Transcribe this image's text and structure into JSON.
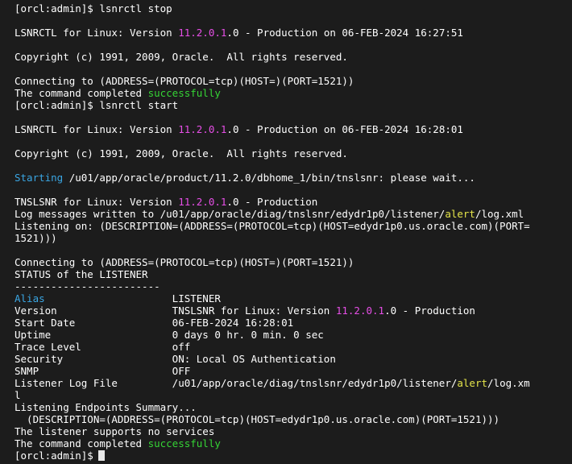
{
  "colors": {
    "background": "#1c1c1c",
    "text": "#ffffff",
    "version": "#e64ee6",
    "success": "#35d435",
    "keyword": "#3aa6e3",
    "highlight": "#e5e54a",
    "cursor": "#e8e8e8"
  },
  "terminal": {
    "lines": [
      [
        {
          "t": "[orcl:admin]$ lsnrctl stop"
        }
      ],
      [],
      [
        {
          "t": "LSNRCTL for Linux: Version "
        },
        {
          "t": "11.2.0.1",
          "c": "version"
        },
        {
          "t": ".0 - Production on 06-FEB-2024 16:27:51"
        }
      ],
      [],
      [
        {
          "t": "Copyright (c) 1991, 2009, Oracle.  All rights reserved."
        }
      ],
      [],
      [
        {
          "t": "Connecting to (ADDRESS=(PROTOCOL=tcp)(HOST=)(PORT=1521))"
        }
      ],
      [
        {
          "t": "The command completed "
        },
        {
          "t": "successfully",
          "c": "success"
        }
      ],
      [
        {
          "t": "[orcl:admin]$ lsnrctl start"
        }
      ],
      [],
      [
        {
          "t": "LSNRCTL for Linux: Version "
        },
        {
          "t": "11.2.0.1",
          "c": "version"
        },
        {
          "t": ".0 - Production on 06-FEB-2024 16:28:01"
        }
      ],
      [],
      [
        {
          "t": "Copyright (c) 1991, 2009, Oracle.  All rights reserved."
        }
      ],
      [],
      [
        {
          "t": "Starting",
          "c": "keyword"
        },
        {
          "t": " /u01/app/oracle/product/11.2.0/dbhome_1/bin/tnslsnr: please wait..."
        }
      ],
      [],
      [
        {
          "t": "TNSLSNR for Linux: Version "
        },
        {
          "t": "11.2.0.1",
          "c": "version"
        },
        {
          "t": ".0 - Production"
        }
      ],
      [
        {
          "t": "Log messages written to /u01/app/oracle/diag/tnslsnr/edydr1p0/listener/"
        },
        {
          "t": "alert",
          "c": "highlight"
        },
        {
          "t": "/log.xml"
        }
      ],
      [
        {
          "t": "Listening on: (DESCRIPTION=(ADDRESS=(PROTOCOL=tcp)(HOST=edydr1p0.us.oracle.com)(PORT="
        }
      ],
      [
        {
          "t": "1521)))"
        }
      ],
      [],
      [
        {
          "t": "Connecting to (ADDRESS=(PROTOCOL=tcp)(HOST=)(PORT=1521))"
        }
      ],
      [
        {
          "t": "STATUS of the LISTENER"
        }
      ],
      [
        {
          "t": "------------------------"
        }
      ],
      [
        {
          "t": "Alias",
          "c": "keyword"
        },
        {
          "t": "                     LISTENER"
        }
      ],
      [
        {
          "t": "Version                   TNSLSNR for Linux: Version "
        },
        {
          "t": "11.2.0.1",
          "c": "version"
        },
        {
          "t": ".0 - Production"
        }
      ],
      [
        {
          "t": "Start Date                06-FEB-2024 16:28:01"
        }
      ],
      [
        {
          "t": "Uptime                    0 days 0 hr. 0 min. 0 sec"
        }
      ],
      [
        {
          "t": "Trace Level               off"
        }
      ],
      [
        {
          "t": "Security                  ON: Local OS Authentication"
        }
      ],
      [
        {
          "t": "SNMP                      OFF"
        }
      ],
      [
        {
          "t": "Listener Log File         /u01/app/oracle/diag/tnslsnr/edydr1p0/listener/"
        },
        {
          "t": "alert",
          "c": "highlight"
        },
        {
          "t": "/log.xm"
        }
      ],
      [
        {
          "t": "l"
        }
      ],
      [
        {
          "t": "Listening Endpoints Summary..."
        }
      ],
      [
        {
          "t": "  (DESCRIPTION=(ADDRESS=(PROTOCOL=tcp)(HOST=edydr1p0.us.oracle.com)(PORT=1521)))"
        }
      ],
      [
        {
          "t": "The listener supports no services"
        }
      ],
      [
        {
          "t": "The command completed "
        },
        {
          "t": "successfully",
          "c": "success"
        }
      ],
      [
        {
          "t": "[orcl:admin]$"
        }
      ]
    ]
  }
}
